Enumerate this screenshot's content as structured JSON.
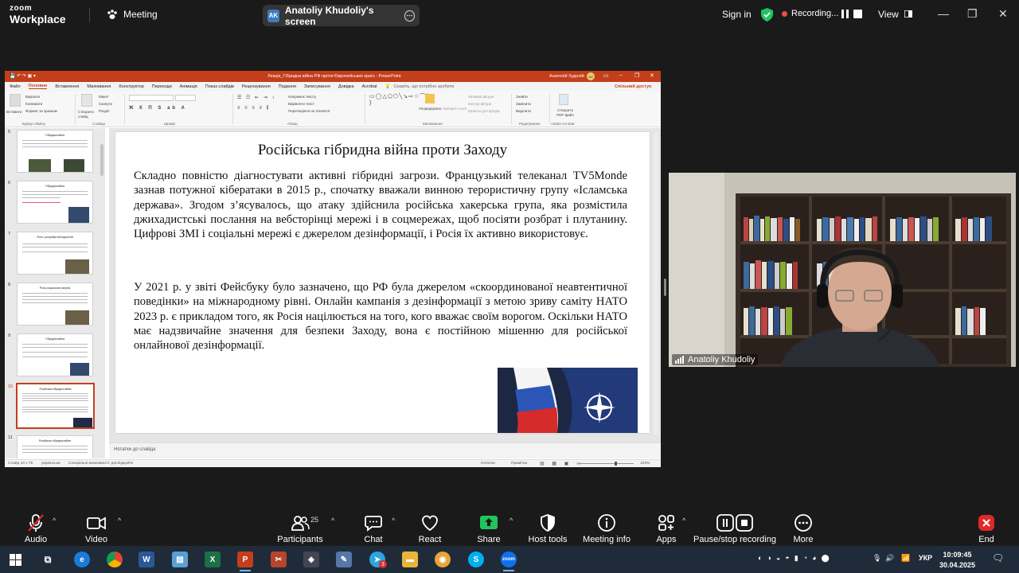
{
  "zoom": {
    "logo_line1": "zoom",
    "logo_line2": "Workplace",
    "meeting_label": "Meeting",
    "screen_share_avatar": "AK",
    "screen_share_title": "Anatoliy Khudoliy's screen",
    "sign_in": "Sign in",
    "recording_label": "Recording...",
    "view_label": "View",
    "accent_color": "#0e72ed",
    "recording_color": "#e8513f"
  },
  "powerpoint": {
    "window_title": "Лекція_Гібридна війна РФ проти Європейських країн  -  PowerPoint",
    "user_name": "Анатолій Худолій",
    "user_initials": "АХ",
    "tabs": [
      "Файл",
      "Основне",
      "Вставлення",
      "Малювання",
      "Конструктор",
      "Переходи",
      "Анімація",
      "Показ слайдів",
      "Рецензування",
      "Подання",
      "Записування",
      "Довідка",
      "Acrobat"
    ],
    "active_tab": "Основне",
    "search_hint": "Скажіть, що потрібно зробити",
    "share_label": "Спільний доступ",
    "ribbon_groups": {
      "clipboard": "Буфер обміну",
      "slides": "Слайди",
      "font": "Шрифт",
      "paragraph": "Абзац",
      "drawing": "Малювання",
      "editing": "Редагування",
      "adobe": "Adobe Acrobat"
    },
    "ribbon_items": {
      "paste": "Вставити",
      "cut": "Вирізати",
      "copy": "Копіювати",
      "format_painter": "Формат за зразком",
      "new_slide": "Створити слайд",
      "layout": "Макет",
      "reset": "Скинути",
      "section": "Розділ",
      "text_direction": "Напрямок тексту",
      "align_text": "Вирівняти текст",
      "convert_smartart": "Перетворити на SmartArt",
      "arrange": "Упорядкувати",
      "quick_styles": "Експрес-стилі",
      "shape_fill": "Заливка фігури",
      "shape_outline": "Контур фігури",
      "shape_effects": "Ефекти для фігури",
      "find": "Знайти",
      "replace": "Замінити",
      "select": "Виділити",
      "create_pdf": "Створити PDF-файл"
    },
    "thumbnail_numbers": [
      "5",
      "6",
      "7",
      "8",
      "9",
      "10",
      "11"
    ],
    "thumbnail_titles": [
      "Гібридна війна",
      "Гібридна війна",
      "Фото: розробка методологій",
      "Роль соціальних мереж",
      "Гібридна війна",
      "Російська гібридна війна",
      "Російська гібридна війна"
    ],
    "selected_thumbnail": "10",
    "slide": {
      "title": "Російська гібридна війна проти Заходу",
      "paragraph1": "Складно повністю діагностувати активні гібридні загрози. Французький телеканал TV5Monde зазнав потужної кібератаки в 2015 р., спочатку вважали винною терористичну групу «Ісламська держава». Згодом з’ясувалось, що атаку здійснила російська хакерська група, яка розмістила джихадистські послання на вебсторінці мережі і в соцмережах, щоб посіяти розбрат і плутанину. Цифрові ЗМІ і соціальні мережі є джерелом дезінформації, і Росія їх активно використовує.",
      "paragraph2": "У 2021 р. у звіті Фейсбуку було зазначено, що РФ була джерелом «скоординованої неавтентичної поведінки» на міжнародному рівні. Онлайн кампанія з дезінформації з метою зриву саміту НАТО 2023 р. є прикладом того, як Росія націлюється на того, кого вважає своїм ворогом. Оскільки НАТО має надзвичайне значення для безпеки Заходу, вона є постійною мішенню для російської онлайнової дезінформації."
    },
    "notes_placeholder": "Нотатки до слайда",
    "status": {
      "slide_count": "Слайд 10 з 75",
      "language": "українська",
      "accessibility": "Спеціальні можливості: досліджуйте",
      "notes_btn": "Нотатки",
      "comments_btn": "Примітки",
      "zoom": "103%"
    },
    "accent_color": "#c43e1c"
  },
  "participant": {
    "name": "Anatoliy Khudoliy"
  },
  "toolbar": {
    "audio": "Audio",
    "video": "Video",
    "participants": "Participants",
    "participants_count": "25",
    "chat": "Chat",
    "react": "React",
    "share": "Share",
    "host_tools": "Host tools",
    "meeting_info": "Meeting info",
    "apps": "Apps",
    "pause_stop_recording": "Pause/stop recording",
    "more": "More",
    "end": "End",
    "share_color": "#23c45e",
    "end_color": "#e02828"
  },
  "taskbar": {
    "language": "УКР",
    "time": "10:09:45",
    "date": "30.04.2025",
    "chrome_badge": "3"
  }
}
